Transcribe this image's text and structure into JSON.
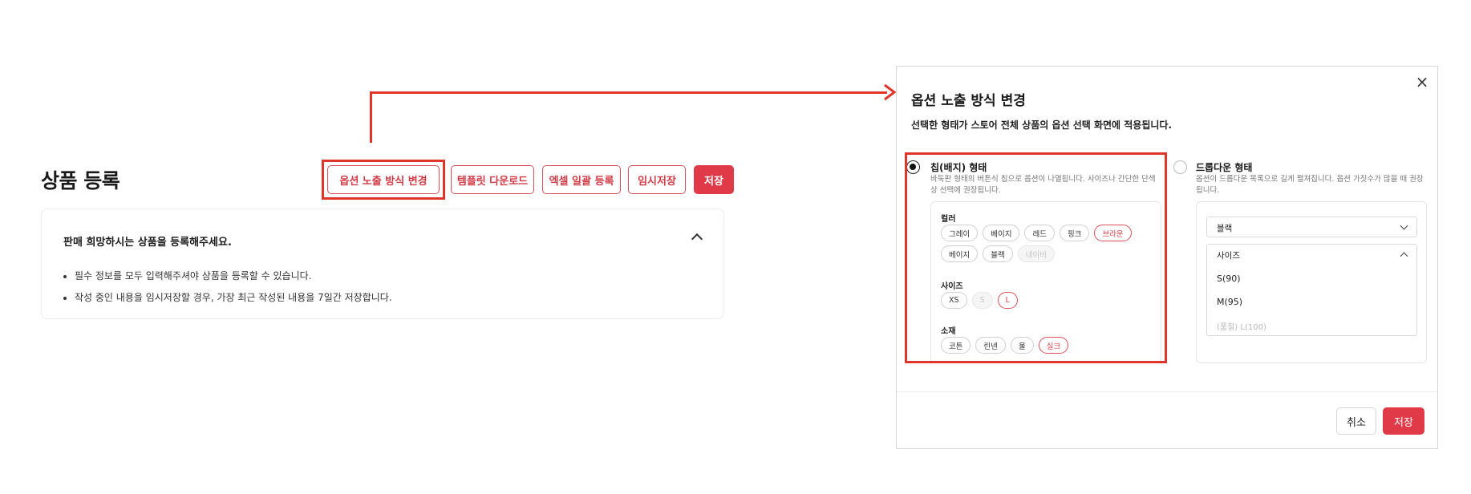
{
  "page": {
    "title": "상품 등록",
    "buttons": {
      "option_display": "옵션 노출 방식 변경",
      "template_download": "템플릿 다운로드",
      "excel_upload": "엑셀 일괄 등록",
      "temp_save": "임시저장",
      "save": "저장"
    },
    "notice": {
      "title": "판매 희망하시는 상품을 등록해주세요.",
      "items": [
        "필수 정보를 모두 입력해주셔야 상품을 등록할 수 있습니다.",
        "작성 중인 내용을 임시저장할 경우, 가장 최근 작성된 내용을 7일간 저장합니다."
      ]
    }
  },
  "modal": {
    "close_glyph": "×",
    "title": "옵션 노출 방식 변경",
    "subtitle": "선택한 형태가 스토어 전체 상품의 옵션 선택 화면에 적용됩니다.",
    "chip_option": {
      "title": "칩(배지) 형태",
      "desc": "바둑판 형태의 버튼식 칩으로 옵션이 나열됩니다. 사이즈나 간단한 단색 상 선택에 권장됩니다.",
      "selected": true,
      "groups": [
        {
          "label": "컬러",
          "chips": [
            {
              "text": "그레이",
              "state": "normal"
            },
            {
              "text": "베이지",
              "state": "normal"
            },
            {
              "text": "레드",
              "state": "normal"
            },
            {
              "text": "핑크",
              "state": "normal"
            },
            {
              "text": "브라운",
              "state": "selected"
            },
            {
              "text": "베이지",
              "state": "normal"
            },
            {
              "text": "블랙",
              "state": "normal"
            },
            {
              "text": "네이비",
              "state": "disabled"
            }
          ]
        },
        {
          "label": "사이즈",
          "chips": [
            {
              "text": "XS",
              "state": "normal"
            },
            {
              "text": "S",
              "state": "disabled"
            },
            {
              "text": "L",
              "state": "selected"
            }
          ]
        },
        {
          "label": "소재",
          "chips": [
            {
              "text": "코튼",
              "state": "normal"
            },
            {
              "text": "린넨",
              "state": "normal"
            },
            {
              "text": "울",
              "state": "normal"
            },
            {
              "text": "실크",
              "state": "selected"
            }
          ]
        }
      ]
    },
    "dropdown_option": {
      "title": "드롭다운 형태",
      "desc": "옵션이 드롭다운 목록으로 길게 펼쳐집니다. 옵션 가짓수가 많을 때 권장됩니다.",
      "selected": false,
      "color_value": "블랙",
      "size_label": "사이즈",
      "size_items": [
        {
          "text": "S(90)",
          "state": "normal"
        },
        {
          "text": "M(95)",
          "state": "normal"
        },
        {
          "text": "(품절) L(100)",
          "state": "disabled"
        }
      ]
    },
    "footer": {
      "cancel": "취소",
      "save": "저장"
    }
  },
  "colors": {
    "accent": "#e03a48",
    "highlight": "#e0352b"
  }
}
